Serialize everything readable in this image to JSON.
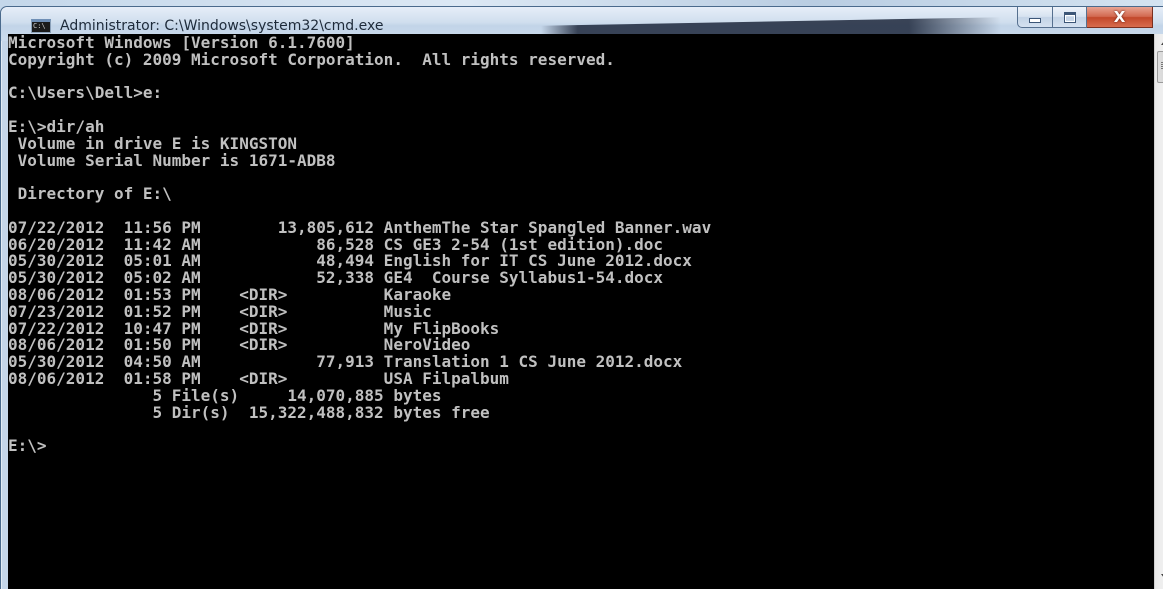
{
  "window": {
    "title": "Administrator: C:\\Windows\\system32\\cmd.exe",
    "icon": "cmd-icon",
    "icon_text": "C:\\",
    "buttons": {
      "minimize": "minimize-icon",
      "maximize": "maximize-icon",
      "close": "close-icon",
      "close_glyph": "X"
    }
  },
  "console": {
    "lines": [
      "Microsoft Windows [Version 6.1.7600]",
      "Copyright (c) 2009 Microsoft Corporation.  All rights reserved.",
      "",
      "C:\\Users\\Dell>e:",
      "",
      "E:\\>dir/ah",
      " Volume in drive E is KINGSTON",
      " Volume Serial Number is 1671-ADB8",
      "",
      " Directory of E:\\",
      "",
      "07/22/2012  11:56 PM        13,805,612 AnthemThe Star Spangled Banner.wav",
      "06/20/2012  11:42 AM            86,528 CS GE3 2-54 (1st edition).doc",
      "05/30/2012  05:01 AM            48,494 English for IT CS June 2012.docx",
      "05/30/2012  05:02 AM            52,338 GE4  Course Syllabus1-54.docx",
      "08/06/2012  01:53 PM    <DIR>          Karaoke",
      "07/23/2012  01:52 PM    <DIR>          Music",
      "07/22/2012  10:47 PM    <DIR>          My FlipBooks",
      "08/06/2012  01:50 PM    <DIR>          NeroVideo",
      "05/30/2012  04:50 AM            77,913 Translation 1 CS June 2012.docx",
      "08/06/2012  01:58 PM    <DIR>          USA Filpalbum",
      "               5 File(s)     14,070,885 bytes",
      "               5 Dir(s)  15,322,488,832 bytes free",
      "",
      "E:\\>"
    ]
  },
  "colors": {
    "console_background": "#000000",
    "console_text": "#c0c0c0",
    "close_button": "#c2472a"
  }
}
